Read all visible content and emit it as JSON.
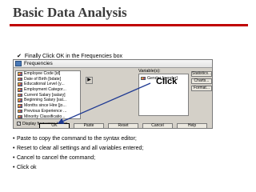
{
  "slide": {
    "title": "Basic Data Analysis",
    "intro_text": "Finally Click OK in the Frequencies box",
    "bullets": [
      "Paste to copy the command to the syntax editor;",
      "Reset to clear all settings and all variables entered;",
      "Cancel to cancel the command;",
      "Click ok"
    ]
  },
  "dialog": {
    "title": "Frequencies",
    "variable_list": [
      "Employee Code [id]",
      "Date of Birth [bdate]",
      "Educational Level (y...",
      "Employment Categor...",
      "Current Salary [salary]",
      "Beginning Salary [sal...",
      "Months since Hire [jo...",
      "Previous Experience ...",
      "Minority Classificatio..."
    ],
    "variables_label": "Variable(s):",
    "selected_variable": "Gender [gender]",
    "callout": "Click",
    "side_buttons": [
      "Statistics...",
      "Charts...",
      "Format..."
    ],
    "display_tables_label": "Display frequency tables",
    "display_tables_checked": true,
    "buttons": {
      "ok": "OK",
      "paste": "Paste",
      "reset": "Reset",
      "cancel": "Cancel",
      "help": "Help"
    }
  },
  "colors": {
    "title_rule": "#c00000",
    "arrow": "#1f3a93",
    "dialog_bg": "#d4d0c8"
  }
}
